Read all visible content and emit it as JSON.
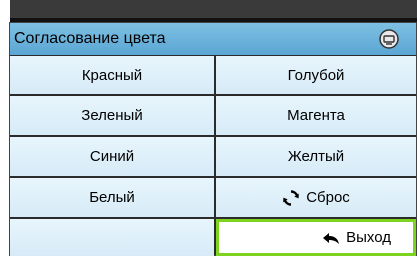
{
  "menu": {
    "title": "Согласование цвета",
    "title_icon": "projector-icon"
  },
  "items": {
    "red": "Красный",
    "cyan": "Голубой",
    "green": "Зеленый",
    "magenta": "Магента",
    "blue": "Синий",
    "yellow": "Желтый",
    "white": "Белый",
    "reset": "Сброс",
    "exit": "Выход"
  },
  "icons": {
    "reset": "reset-icon",
    "exit": "return-arrow-icon"
  },
  "colors": {
    "title_bar": "#6cb3dc",
    "cell": "#dff0fa",
    "focus_border": "#7ed321",
    "frame": "#2b2b2b"
  }
}
